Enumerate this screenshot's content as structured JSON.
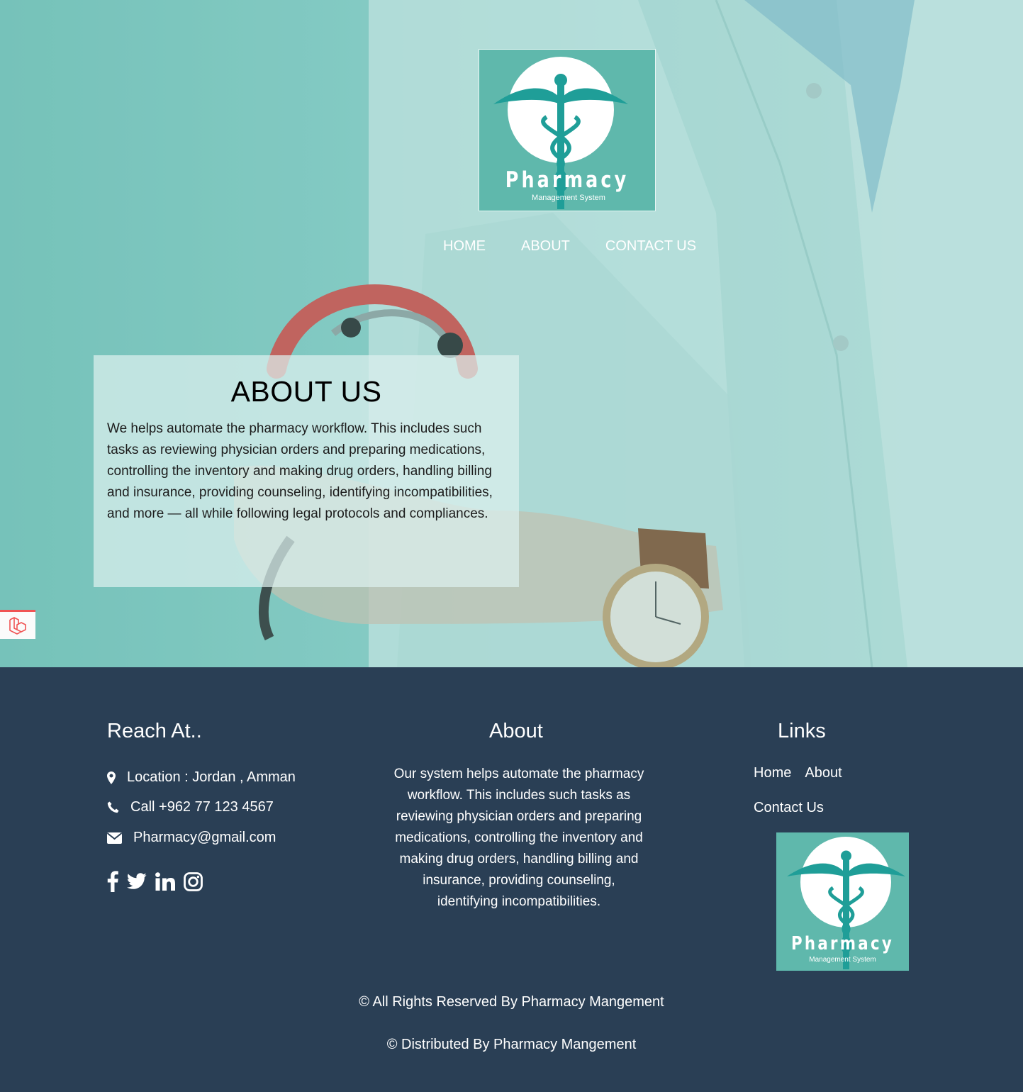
{
  "logo": {
    "title": "Pharmacy",
    "subtitle": "Management System"
  },
  "nav": {
    "items": [
      {
        "label": "HOME"
      },
      {
        "label": "ABOUT"
      },
      {
        "label": "CONTACT US"
      }
    ]
  },
  "about_card": {
    "heading": "ABOUT US",
    "body": "We helps automate the pharmacy workflow. This includes such tasks as reviewing physician orders and preparing medications, controlling the inventory and making drug orders, handling billing and insurance, providing counseling, identifying incompatibilities, and more — all while following legal protocols and compliances."
  },
  "footer": {
    "reach": {
      "heading": "Reach At..",
      "location": "Location : Jordan , Amman",
      "call": "Call +962 77 123 4567",
      "email": "Pharmacy@gmail.com",
      "socials": [
        "facebook-icon",
        "twitter-icon",
        "linkedin-icon",
        "instagram-icon"
      ]
    },
    "about": {
      "heading": "About",
      "text": "Our system helps automate the pharmacy workflow. This includes such tasks as reviewing physician orders and preparing medications, controlling the inventory and making drug orders, handling billing and insurance, providing counseling, identifying incompatibilities."
    },
    "links": {
      "heading": "Links",
      "home": "Home",
      "about": "About",
      "contact": "Contact Us"
    },
    "copyright": "© All Rights Reserved By Pharmacy Mangement",
    "distributed": "© Distributed By Pharmacy Mangement"
  },
  "colors": {
    "brand_teal": "#5fb8ac",
    "footer_bg": "#2a3f55",
    "laravel_red": "#f05454"
  }
}
